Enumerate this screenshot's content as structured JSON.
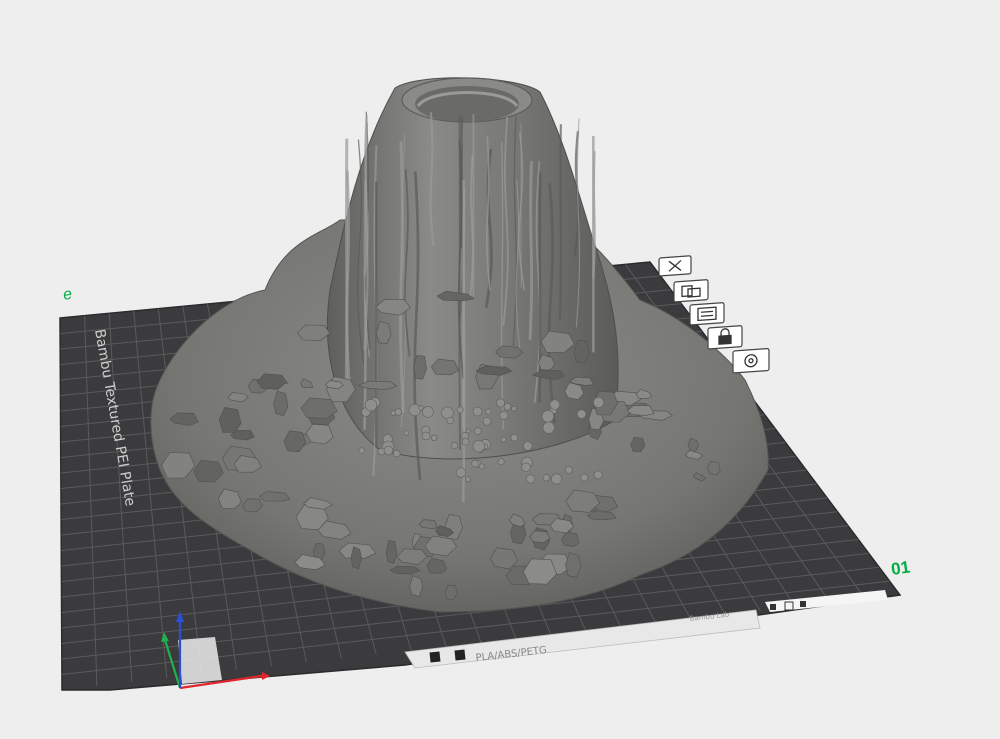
{
  "viewport": {
    "plate_number": "01",
    "plate_label": "Bambu Textured PEI Plate",
    "bottom_strip_text": "PLA/ABS/PETG",
    "bottom_strip_small_text": "Bambu Lab",
    "corner_mark": "e",
    "colors": {
      "background": "#eeeeee",
      "plate": "#3b3b3d",
      "grid": "#5a5a5c",
      "model": "#7c7d7a",
      "accent_green": "#00ae42",
      "axis_x": "#e0262b",
      "axis_y": "#1fb24a",
      "axis_z": "#2a4fd6"
    }
  },
  "plate_toolbar": [
    {
      "name": "close-plate-icon"
    },
    {
      "name": "arrange-icon"
    },
    {
      "name": "auto-orient-icon"
    },
    {
      "name": "lock-icon"
    },
    {
      "name": "plate-settings-icon"
    }
  ],
  "model": {
    "name": "volcano-model"
  }
}
